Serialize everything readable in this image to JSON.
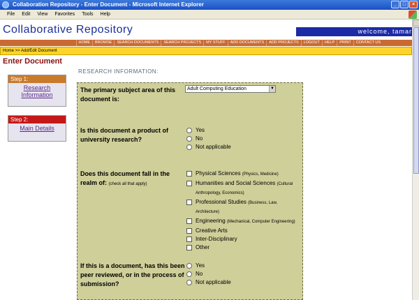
{
  "window": {
    "title": "Collaboration Repository - Enter Document - Microsoft Internet Explorer"
  },
  "menu": [
    "File",
    "Edit",
    "View",
    "Favorites",
    "Tools",
    "Help"
  ],
  "header": {
    "site_title": "Collaborative Repository",
    "welcome": "welcome, tamara"
  },
  "nav": [
    "HOME",
    "BROWSE",
    "SEARCH DOCUMENTS",
    "SEARCH PROJECTS",
    "MY STUFF",
    "ADD DOCUMENTS",
    "ADD PROJECTS",
    "LOGOUT",
    "HELP",
    "PRINT",
    "CONTACT US"
  ],
  "breadcrumb": "Home >> Add/Edit Document",
  "page_title": "Enter Document",
  "steps": [
    {
      "label": "Step 1:",
      "link": "Research Information"
    },
    {
      "label": "Step 2:",
      "link": "Main Details"
    }
  ],
  "section_heading": "RESEARCH INFORMATION:",
  "form": {
    "q1": {
      "label": "The primary subject area of this document is:",
      "selected": "Adult Computing Education"
    },
    "q2": {
      "label": "Is this document a product of university research?",
      "options": [
        "Yes",
        "No",
        "Not applicable"
      ]
    },
    "q3": {
      "label": "Does this document fall in the realm of:",
      "hint": "(check all that apply)",
      "options": [
        {
          "name": "Physical Sciences",
          "sub": "(Physics, Medicine)"
        },
        {
          "name": "Humanities and Social Sciences",
          "sub": "(Cultural Anthropology, Economics)"
        },
        {
          "name": "Professional Studies",
          "sub": "(Business, Law, Architecture)"
        },
        {
          "name": "Engineering",
          "sub": "(Mechanical, Computer Engineering)"
        },
        {
          "name": "Creative Arts",
          "sub": ""
        },
        {
          "name": "Inter-Disciplinary",
          "sub": ""
        },
        {
          "name": "Other",
          "sub": ""
        }
      ]
    },
    "q4": {
      "label": "If this is a document, has this been peer reviewed, or in the process of submission?",
      "options": [
        "Yes",
        "No",
        "Not applicable"
      ]
    }
  }
}
